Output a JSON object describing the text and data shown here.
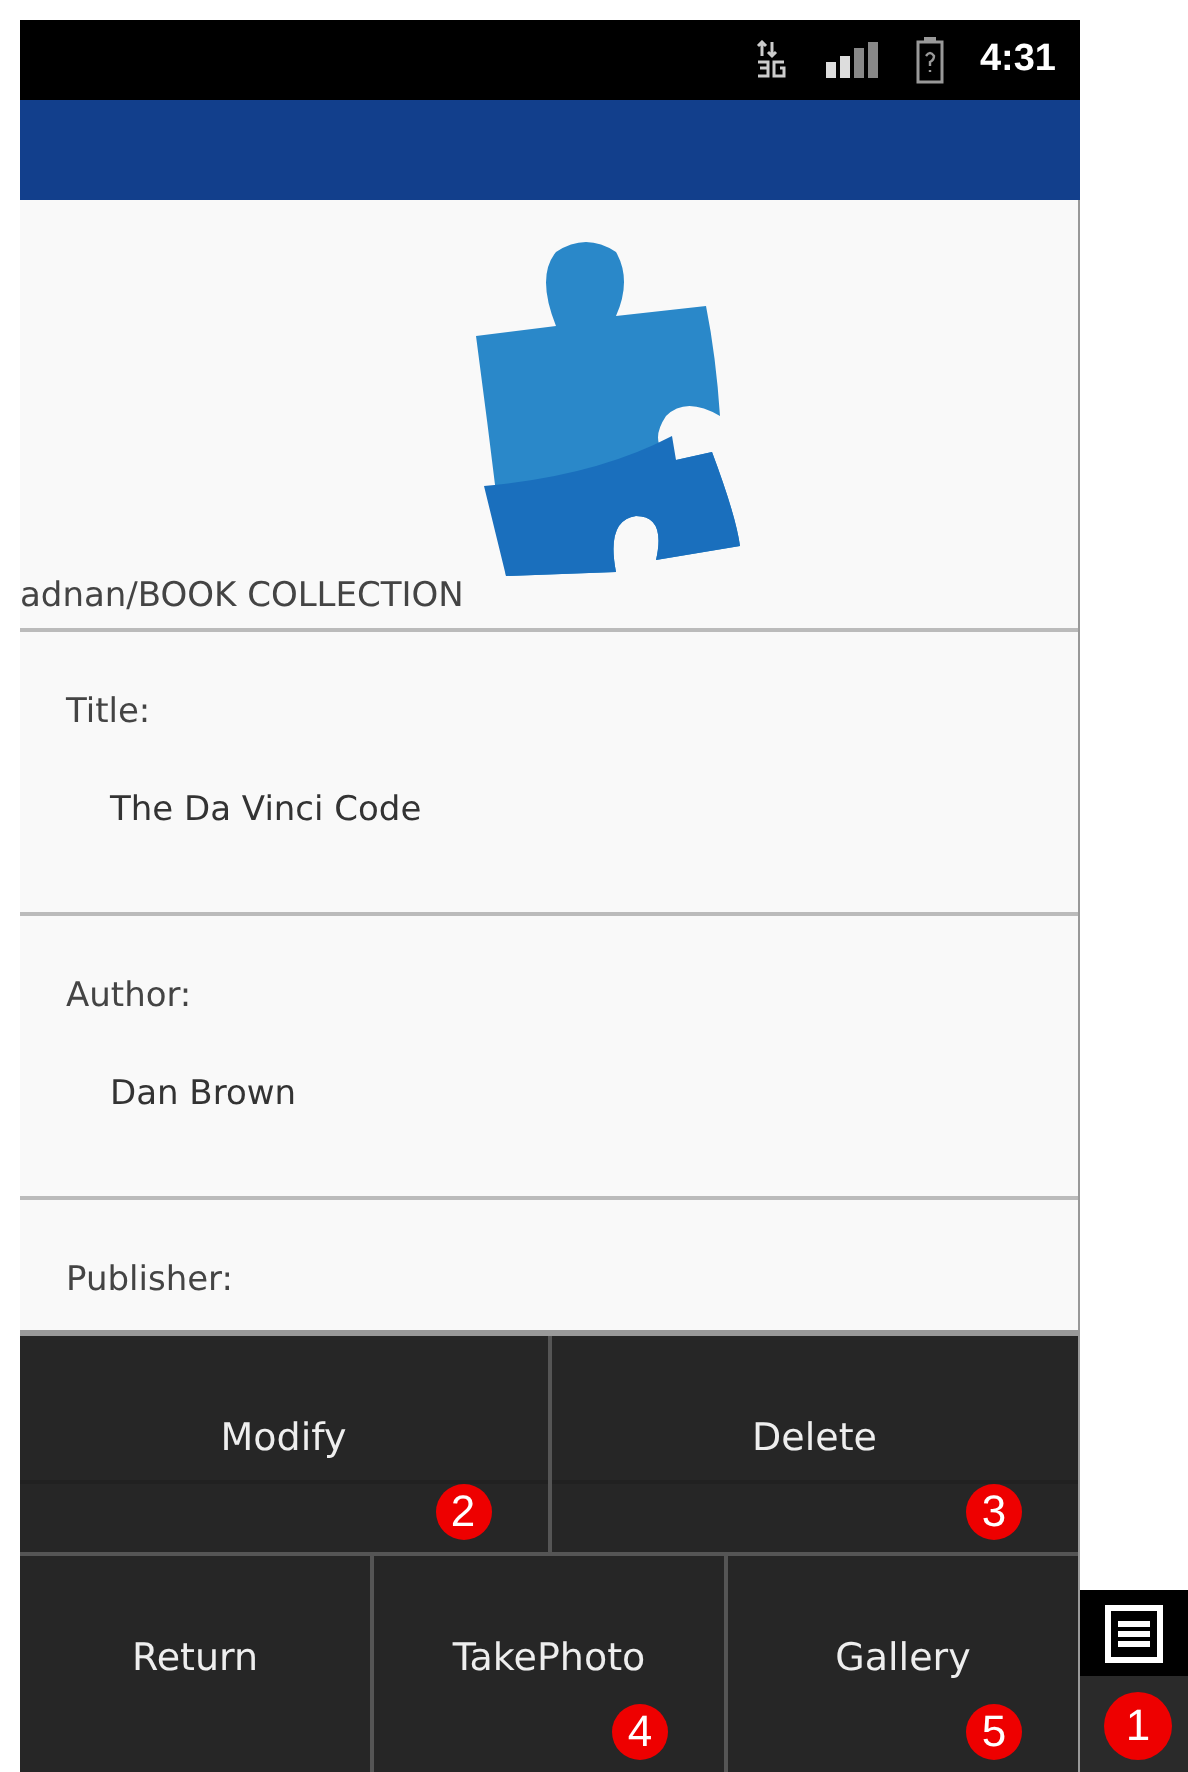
{
  "status_bar": {
    "time": "4:31"
  },
  "app": {
    "path": "adnan/BOOK COLLECTION"
  },
  "fields": [
    {
      "label": "Title:",
      "value": "The Da Vinci Code"
    },
    {
      "label": "Author:",
      "value": "Dan Brown"
    },
    {
      "label": "Publisher:"
    }
  ],
  "menu": {
    "items": [
      {
        "label": "Modify",
        "badge": "2"
      },
      {
        "label": "Delete",
        "badge": "3"
      },
      {
        "label": "Return"
      },
      {
        "label": "TakePhoto",
        "badge": "4"
      },
      {
        "label": "Gallery",
        "badge": "5"
      }
    ]
  },
  "menu_key": {
    "badge": "1"
  }
}
